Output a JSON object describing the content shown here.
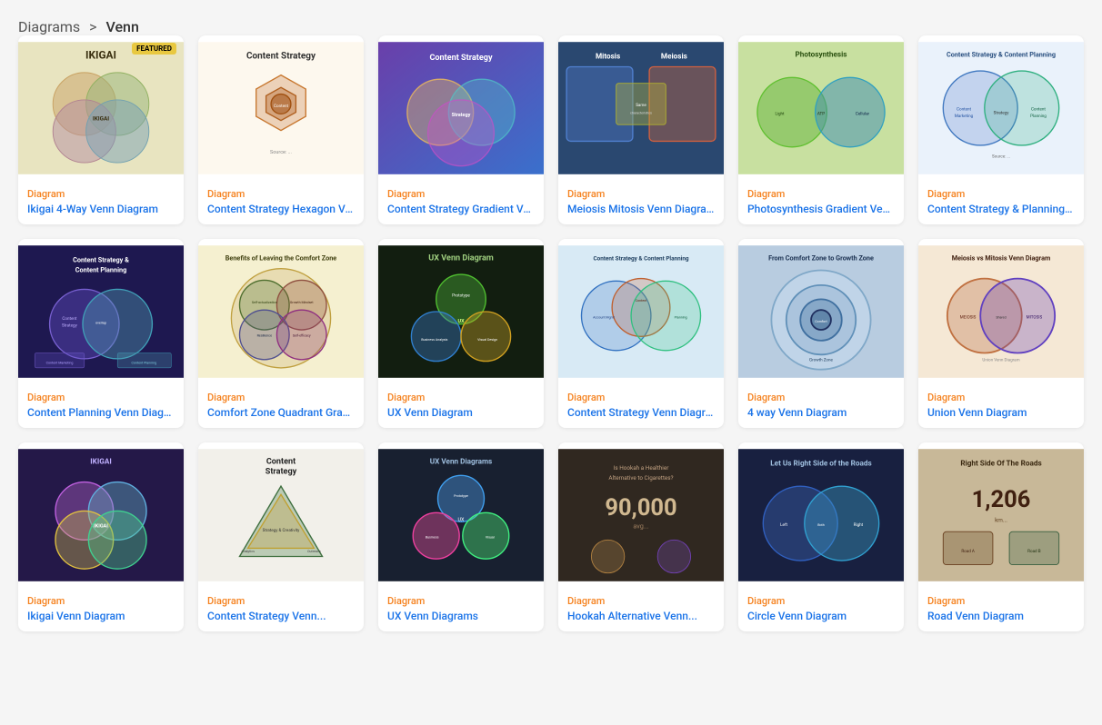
{
  "breadcrumb": {
    "parent": "Diagrams",
    "separator": ">",
    "current": "Venn"
  },
  "cards": [
    {
      "id": "ikigai",
      "featured": true,
      "category": "Diagram",
      "title": "Ikigai 4-Way Venn Diagram",
      "bg": "#e8e4c8",
      "accent": "#8a7a48"
    },
    {
      "id": "content-strategy-hex",
      "featured": false,
      "category": "Diagram",
      "title": "Content Strategy Hexagon Venn...",
      "bg": "#f9f3e8",
      "accent": "#c8783a"
    },
    {
      "id": "content-strategy-grad",
      "featured": false,
      "category": "Diagram",
      "title": "Content Strategy Gradient Venn...",
      "bg": "#5a3fa0",
      "accent": "#a080e0"
    },
    {
      "id": "meiosis",
      "featured": false,
      "category": "Diagram",
      "title": "Meiosis Mitosis Venn Diagram",
      "bg": "#2a4870",
      "accent": "#4a80b0"
    },
    {
      "id": "photosynthesis",
      "featured": false,
      "category": "Diagram",
      "title": "Photosynthesis Gradient Venn D...",
      "bg": "#7ab040",
      "accent": "#a0c860"
    },
    {
      "id": "content-planning-1",
      "featured": false,
      "category": "Diagram",
      "title": "Content Strategy & Planning Ve...",
      "bg": "#e8f0f8",
      "accent": "#4080c0"
    },
    {
      "id": "content-planning-dark",
      "featured": false,
      "category": "Diagram",
      "title": "Content Planning Venn Diagram",
      "bg": "#1e1850",
      "accent": "#6050a0"
    },
    {
      "id": "comfort-zone",
      "featured": false,
      "category": "Diagram",
      "title": "Comfort Zone Quadrant Graph",
      "bg": "#f5efcc",
      "accent": "#c8a830"
    },
    {
      "id": "ux-venn",
      "featured": false,
      "category": "Diagram",
      "title": "UX Venn Diagram",
      "bg": "#121e10",
      "accent": "#4a8a30"
    },
    {
      "id": "content-strategy-venn",
      "featured": false,
      "category": "Diagram",
      "title": "Content Strategy Venn Diagram",
      "bg": "#d8e8f0",
      "accent": "#3070a0"
    },
    {
      "id": "4way-venn",
      "featured": false,
      "category": "Diagram",
      "title": "4 way Venn Diagram",
      "bg": "#c0d4e8",
      "accent": "#4878a8"
    },
    {
      "id": "union-venn",
      "featured": false,
      "category": "Diagram",
      "title": "Union Venn Diagram",
      "bg": "#f0e8d8",
      "accent": "#a08060"
    },
    {
      "id": "ikigai-2",
      "featured": false,
      "category": "Diagram",
      "title": "Ikigai Venn Diagram",
      "bg": "#241848",
      "accent": "#7060c0"
    },
    {
      "id": "content-strategy-2",
      "featured": false,
      "category": "Diagram",
      "title": "Content Strategy Venn...",
      "bg": "#f2f0ea",
      "accent": "#404040"
    },
    {
      "id": "ux-venn-2",
      "featured": false,
      "category": "Diagram",
      "title": "UX Venn Diagrams",
      "bg": "#182030",
      "accent": "#3060a0"
    },
    {
      "id": "hookah",
      "featured": false,
      "category": "Diagram",
      "title": "Hookah Alternative Venn...",
      "bg": "#302820",
      "accent": "#806040"
    },
    {
      "id": "circle",
      "featured": false,
      "category": "Diagram",
      "title": "Circle Venn Diagram",
      "bg": "#182040",
      "accent": "#3858a0"
    },
    {
      "id": "road",
      "featured": false,
      "category": "Diagram",
      "title": "Road Venn Diagram",
      "bg": "#c8b898",
      "accent": "#806848"
    }
  ]
}
